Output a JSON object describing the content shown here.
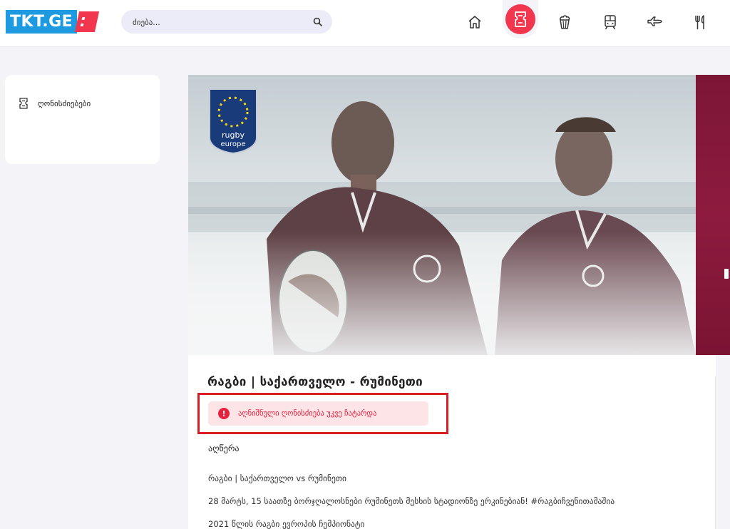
{
  "header": {
    "logo_text": "TKT.GE",
    "search": {
      "placeholder": "ძიება..."
    },
    "nav": [
      {
        "name": "home-icon"
      },
      {
        "name": "ticket-icon",
        "active": true
      },
      {
        "name": "popcorn-icon"
      },
      {
        "name": "train-icon"
      },
      {
        "name": "airplane-icon"
      },
      {
        "name": "restaurant-icon"
      }
    ]
  },
  "sidebar": {
    "items": [
      {
        "label": "ღონისძიებები",
        "icon": "ticket-icon"
      }
    ]
  },
  "banner": {
    "logo_line1": "rugby",
    "logo_line2": "europe"
  },
  "event": {
    "title": "რაგბი | საქართველო - რუმინეთი",
    "alert": "აღნიშნული ღონისძიება უკვე ჩატარდა",
    "description_heading": "აღწერა",
    "description": [
      "რაგბი | საქართველო vs რუმინეთი",
      "28 მარტს, 15 საათზე ბორჯღალოსნები რუმინეთს მესხის სტადიონზე ერკინებიან! #რაგბიჩვენითამაშია",
      "2021 წლის რაგბი ევროპის ჩემპიონატი"
    ]
  },
  "colors": {
    "brand_blue": "#1e9be0",
    "accent_red": "#f2364e",
    "alert_bg": "#fde4e7",
    "alert_text": "#e8223d",
    "highlight_border": "#d81e24"
  }
}
